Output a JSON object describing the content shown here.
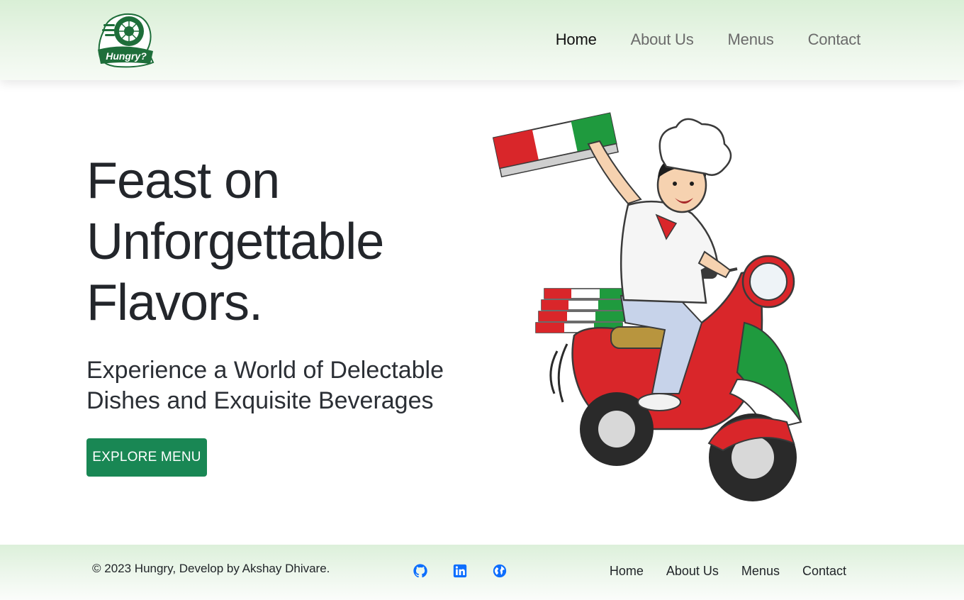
{
  "brand": {
    "logo_text": "Hungry?",
    "primary_color": "#198754",
    "logo_color": "#1e6e3a"
  },
  "nav": {
    "items": [
      {
        "label": "Home",
        "active": true
      },
      {
        "label": "About Us",
        "active": false
      },
      {
        "label": "Menus",
        "active": false
      },
      {
        "label": "Contact",
        "active": false
      }
    ]
  },
  "hero": {
    "title_lines": [
      "Feast on",
      "Unforgettable",
      "Flavors."
    ],
    "subtitle_lines": [
      "Experience a World of Delectable",
      "Dishes and Exquisite Beverages"
    ],
    "cta_label": "EXPLORE MENU",
    "illustration": "chef-on-scooter-with-pizza-illustration"
  },
  "footer": {
    "copyright": "© 2023 Hungry, Develop by Akshay Dhivare.",
    "social_icons": [
      "github-icon",
      "linkedin-icon",
      "globe-icon"
    ],
    "social_color": "#0d6efd",
    "links": [
      "Home",
      "About Us",
      "Menus",
      "Contact"
    ]
  }
}
